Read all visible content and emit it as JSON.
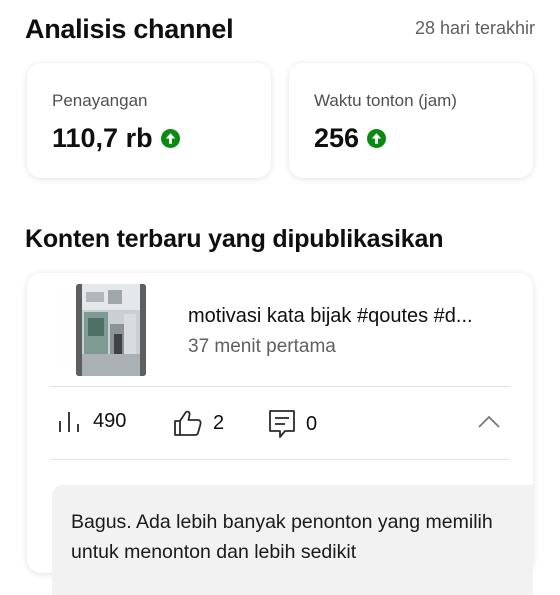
{
  "header": {
    "title": "Analisis channel",
    "period": "28 hari terakhir"
  },
  "stats": [
    {
      "label": "Penayangan",
      "value": "110,7 rb",
      "trend": "up",
      "trend_color": "#0b8a12"
    },
    {
      "label": "Waktu tonton (jam)",
      "value": "256",
      "trend": "up",
      "trend_color": "#0b8a12"
    }
  ],
  "recent": {
    "section_title": "Konten terbaru yang dipublikasikan",
    "video": {
      "title": "motivasi kata bijak #qoutes #d...",
      "subtitle": "37 menit pertama",
      "thumbnail_icon": "video-thumbnail"
    },
    "metrics": {
      "views": "490",
      "likes": "2",
      "comments": "0"
    },
    "insight": "Bagus. Ada lebih banyak penonton yang memilih untuk menonton dan lebih sedikit"
  },
  "colors": {
    "accent_up": "#0b8a12",
    "text_primary": "#0f0f0f",
    "text_secondary": "#606060",
    "insight_bg": "#f2f2f2"
  }
}
